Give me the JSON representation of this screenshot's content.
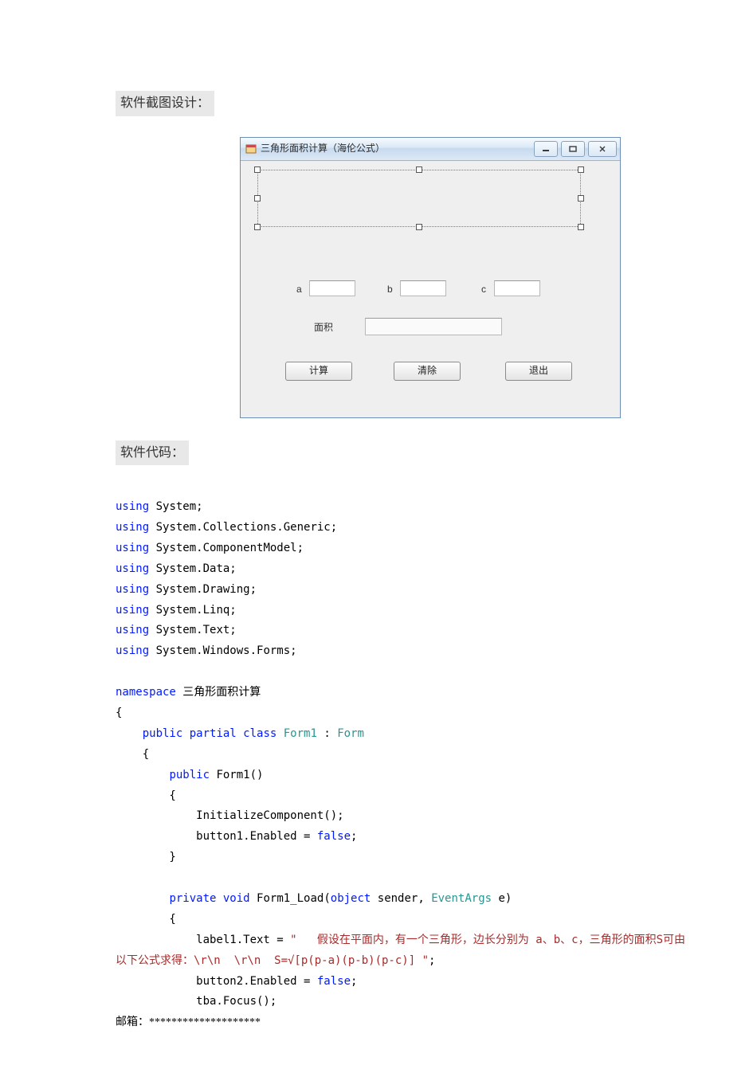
{
  "headings": {
    "screenshot": "软件截图设计：",
    "code": "软件代码："
  },
  "window": {
    "title": "三角形面积计算（海伦公式）",
    "buttons": {
      "min_tip": "最小化",
      "max_tip": "最大化",
      "close_tip": "关闭"
    },
    "labels": {
      "a": "a",
      "b": "b",
      "c": "c",
      "area": "面积"
    },
    "actions": {
      "calc": "计算",
      "clear": "清除",
      "exit": "退出"
    }
  },
  "code": {
    "u1": "using",
    "u1n": " System;",
    "u2n": " System.Collections.Generic;",
    "u3n": " System.ComponentModel;",
    "u4n": " System.Data;",
    "u5n": " System.Drawing;",
    "u6n": " System.Linq;",
    "u7n": " System.Text;",
    "u8n": " System.Windows.Forms;",
    "ns_kw": "namespace",
    "ns_name": " 三角形面积计算",
    "open": "{",
    "close": "}",
    "pub": "public",
    "partial": " partial",
    "class_kw": " class",
    "form1": " Form1",
    "colon": " : ",
    "form_t": "Form",
    "form1_ctor": " Form1()",
    "initcomp": "            InitializeComponent();",
    "btn1false_a": "            button1.Enabled = ",
    "false_kw": "false",
    "semi": ";",
    "priv": "private",
    "void_kw": " void",
    "load_sig_a": " Form1_Load(",
    "object_kw": "object",
    "sender": " sender, ",
    "evargs": "EventArgs",
    "e_close": " e)",
    "label1_a": "            label1.Text = ",
    "label1_str1": "\"   假设在平面内，有一个三角形，边长分别为 a、b、c，三角形的面积S可由",
    "label1_str2": "以下公式求得：\\r\\n  \\r\\n  S=√[p(p-a)(p-b)(p-c)] \"",
    "btn2false_a": "            button2.Enabled = ",
    "tbafocus": "            tba.Focus();"
  },
  "footer": {
    "label": "邮箱：",
    "stars": "********************"
  }
}
